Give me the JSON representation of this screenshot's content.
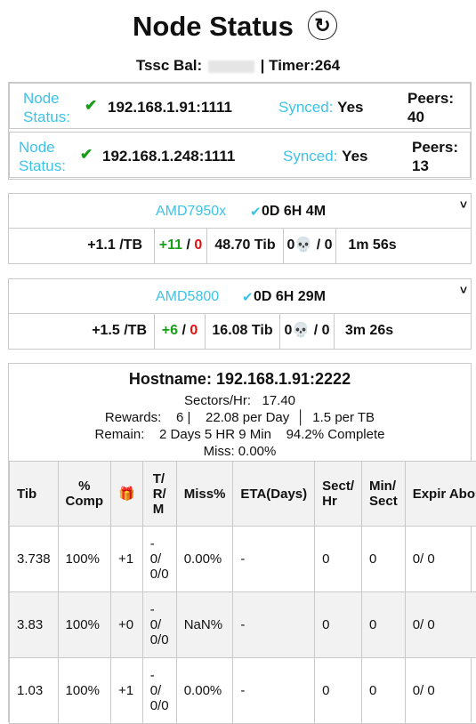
{
  "header": {
    "title": "Node Status",
    "refresh_icon": "↻",
    "balance_label": "Tssc Bal:",
    "timer_text": "| Timer:264"
  },
  "nodes": [
    {
      "label": "Node Status:",
      "address": "192.168.1.91:1111",
      "synced_label": "Synced:",
      "synced_value": "Yes",
      "peers_label": "Peers:",
      "peers": "40"
    },
    {
      "label": "Node Status:",
      "address": "192.168.1.248:1111",
      "synced_label": "Synced:",
      "synced_value": "Yes",
      "peers_label": "Peers:",
      "peers": "13"
    }
  ],
  "machines": [
    {
      "name": "AMD7950x",
      "uptime": "0D 6H 4M",
      "rate": "+1.1 /TB",
      "plus": "+11",
      "minus": "0",
      "tib": "48.70 Tib",
      "skull_count": "0",
      "skull_total": "0",
      "eta": "1m 56s"
    },
    {
      "name": "AMD5800",
      "uptime": "0D 6H 29M",
      "rate": "+1.5 /TB",
      "plus": "+6",
      "minus": "0",
      "tib": "16.08 Tib",
      "skull_count": "0",
      "skull_total": "0",
      "eta": "3m 26s"
    }
  ],
  "host": {
    "title": "Hostname: 192.168.1.91:2222",
    "sectors_line": "Sectors/Hr:   17.40",
    "rewards_line": "Rewards:    6 |    22.08 per Day  │  1.5 per TB",
    "remain_line": "Remain:    2 Days 5 HR 9 Min    94.2% Complete",
    "miss_line": "Miss: 0.00%"
  },
  "table": {
    "headers": [
      "Tib",
      "% Comp",
      "🎁",
      "T/ R/ M",
      "Miss%",
      "ETA(Days)",
      "Sect/ Hr",
      "Min/ Sect",
      "Expir Abou"
    ],
    "rows": [
      [
        "3.738",
        "100%",
        "+1",
        "- 0/ 0/0",
        "0.00%",
        "-",
        "0",
        "0",
        "0/ 0"
      ],
      [
        "3.83",
        "100%",
        "+0",
        "- 0/ 0/0",
        "NaN%",
        "-",
        "0",
        "0",
        "0/ 0"
      ],
      [
        "1.03",
        "100%",
        "+1",
        "- 0/ 0/0",
        "0.00%",
        "-",
        "0",
        "0",
        "0/ 0"
      ]
    ]
  },
  "colors": {
    "accent": "#3cc3e8",
    "green": "#19a019",
    "red": "#e01010",
    "border": "#c9c9c9"
  }
}
